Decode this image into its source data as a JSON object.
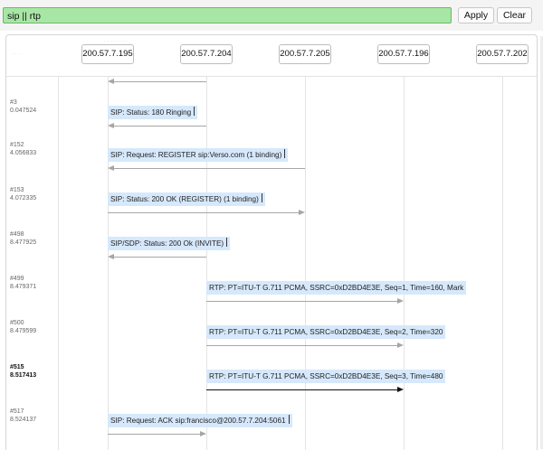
{
  "filter": {
    "value": "sip || rtp"
  },
  "buttons": {
    "apply": "Apply",
    "clear": "Clear"
  },
  "hosts": [
    "200.57.7.195",
    "200.57.7.204",
    "200.57.7.205",
    "200.57.7.196",
    "200.57.7.202"
  ],
  "rows": [
    {
      "num": "#3",
      "time": "0.047524",
      "label": "SIP: Status: 180 Ringing",
      "cursor": true,
      "bold": false,
      "direction": "left",
      "dark": false
    },
    {
      "num": "#152",
      "time": "4.056833",
      "label": "SIP: Request: REGISTER sip:Verso.com  (1 binding)",
      "cursor": true,
      "bold": false,
      "direction": "left",
      "dark": false
    },
    {
      "num": "#153",
      "time": "4.072335",
      "label": "SIP: Status: 200 OK (REGISTER)  (1 binding)",
      "cursor": true,
      "bold": false,
      "direction": "right",
      "dark": false
    },
    {
      "num": "#498",
      "time": "8.477925",
      "label": "SIP/SDP: Status: 200 Ok (INVITE)",
      "cursor": true,
      "bold": false,
      "direction": "left",
      "dark": false
    },
    {
      "num": "#499",
      "time": "8.479371",
      "label": "RTP: PT=ITU-T G.711 PCMA, SSRC=0xD2BD4E3E, Seq=1, Time=160, Mark",
      "cursor": false,
      "bold": false,
      "direction": "right",
      "dark": false
    },
    {
      "num": "#500",
      "time": "8.479599",
      "label": "RTP: PT=ITU-T G.711 PCMA, SSRC=0xD2BD4E3E, Seq=2, Time=320",
      "cursor": false,
      "bold": false,
      "direction": "right",
      "dark": false
    },
    {
      "num": "#515",
      "time": "8.517413",
      "label": "RTP: PT=ITU-T G.711 PCMA, SSRC=0xD2BD4E3E, Seq=3, Time=480",
      "cursor": false,
      "bold": true,
      "direction": "right",
      "dark": true
    },
    {
      "num": "#517",
      "time": "8.524137",
      "label": "SIP: Request: ACK sip:francisco@200.57.7.204:5061",
      "cursor": true,
      "bold": false,
      "direction": "right",
      "dark": false
    }
  ]
}
